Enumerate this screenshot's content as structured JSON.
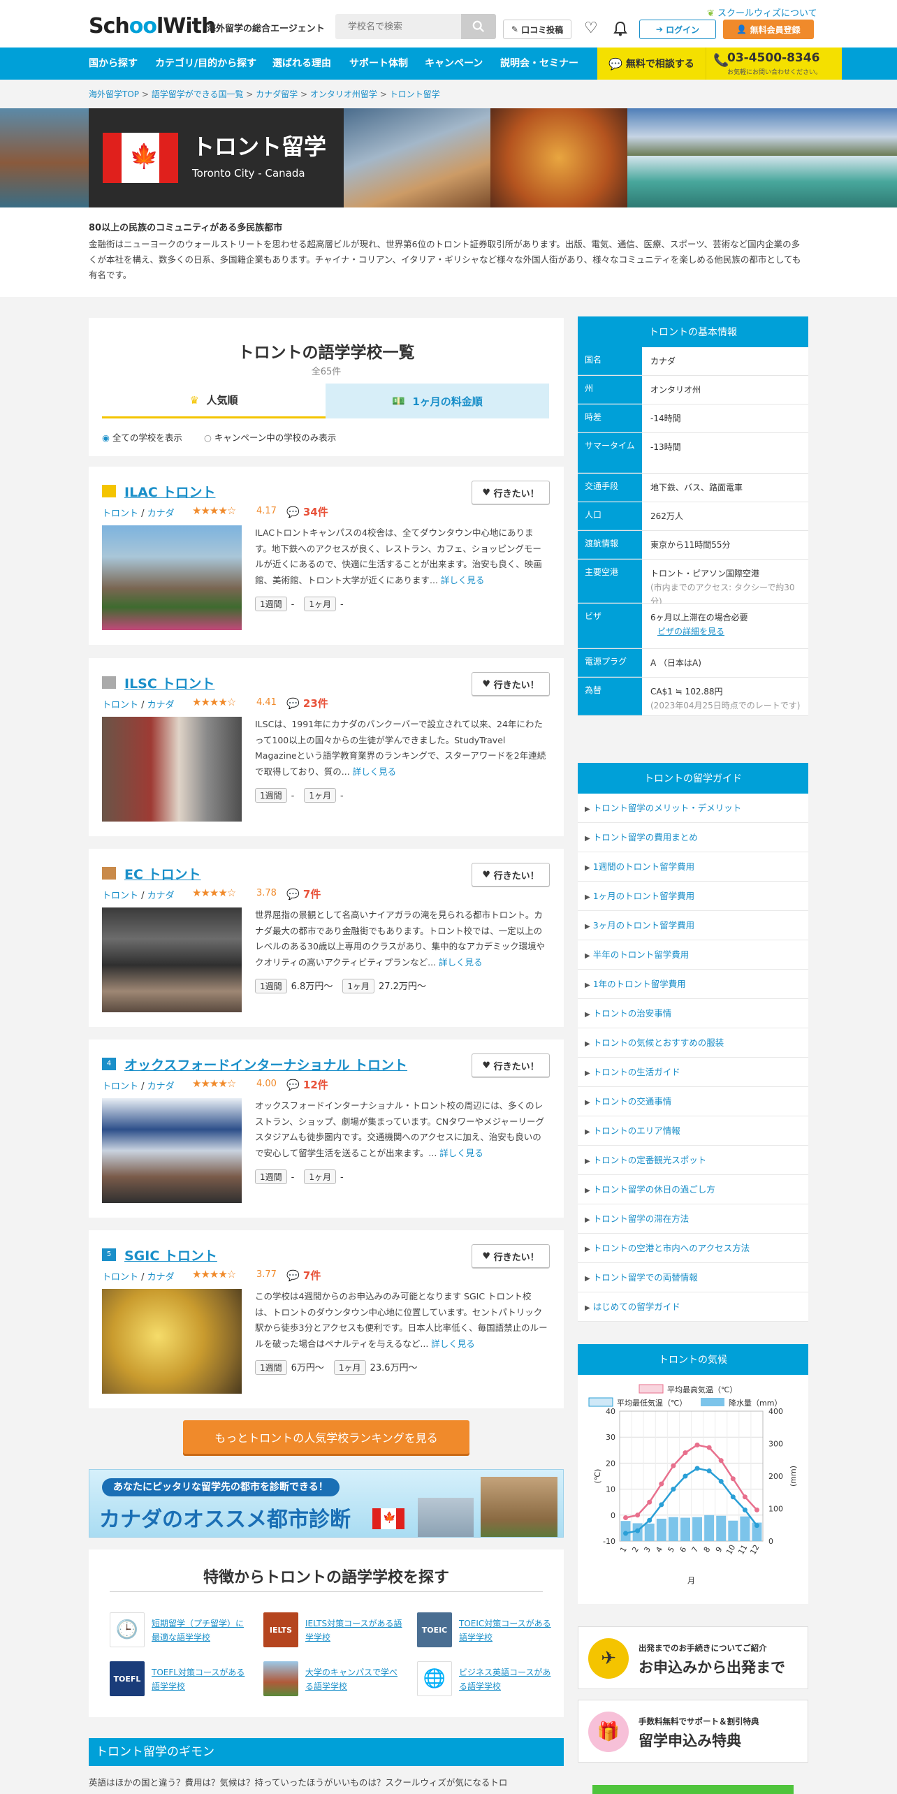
{
  "header": {
    "logo_pre": "Sch",
    "logo_oo": "oo",
    "logo_post": "lWith",
    "tagline": "海外留学の総合エージェント",
    "about": "スクールウィズについて",
    "search_placeholder": "学校名で検索",
    "review_btn": "口コミ投稿",
    "login_btn": "ログイン",
    "register_btn": "無料会員登録"
  },
  "nav": {
    "items": [
      "国から探す",
      "カテゴリ/目的から探す",
      "選ばれる理由",
      "サポート体制",
      "キャンペーン",
      "説明会・セミナー"
    ],
    "consult": "無料で相談する",
    "phone": "03-4500-8346",
    "phone_note": "お気軽にお問い合わせください。"
  },
  "breadcrumb": [
    "海外留学TOP",
    "語学留学ができる国一覧",
    "カナダ留学",
    "オンタリオ州留学",
    "トロント留学"
  ],
  "hero": {
    "title": "トロント留学",
    "subtitle": "Toronto City - Canada"
  },
  "intro": {
    "heading": "80以上の民族のコミュニティがある多民族都市",
    "body": "金融街はニューヨークのウォールストリートを思わせる超高層ビルが現れ、世界第6位のトロント証券取引所があります。出版、電気、通信、医療、スポーツ、芸術など国内企業の多くが本社を構え、数多くの日系、多国籍企業もあります。チャイナ・コリアン、イタリア・ギリシャなど様々な外国人街があり、様々なコミュニティを楽しめる他民族の都市としても有名です。"
  },
  "list": {
    "title": "トロントの語学学校一覧",
    "count": "全65件",
    "tab_popular": "人気順",
    "tab_price": "1ヶ月の料金順",
    "radio_all": "全ての学校を表示",
    "radio_campaign": "キャンペーン中の学校のみ表示",
    "want_label": "行きたい！",
    "loc_city": "トロント",
    "loc_country": "カナダ",
    "week_label": "1週間",
    "month_label": "1ヶ月",
    "more_label": "詳しく見る"
  },
  "schools": [
    {
      "rank": "1",
      "name": "ILAC トロント",
      "rating": "4.17",
      "stars": 4.17,
      "reviews": "34件",
      "desc": "ILACトロントキャンパスの4校舎は、全てダウンタウン中心地にあります。地下鉄へのアクセスが良く、レストラン、カフェ、ショッピングモールが近くにあるので、快適に生活することが出来ます。治安も良く、映画館、美術館、トロント大学が近くにあります...",
      "week_price": "-",
      "month_price": "-"
    },
    {
      "rank": "2",
      "name": "ILSC トロント",
      "rating": "4.41",
      "stars": 4.41,
      "reviews": "23件",
      "desc": "ILSCは、1991年にカナダのバンクーバーで設立されて以来、24年にわたって100以上の国々からの生徒が学んできました。StudyTravel Magazineという語学教育業界のランキングで、スターアワードを2年連続で取得しており、質の...",
      "week_price": "-",
      "month_price": "-"
    },
    {
      "rank": "3",
      "name": "EC トロント",
      "rating": "3.78",
      "stars": 3.78,
      "reviews": "7件",
      "desc": "世界屈指の景観として名高いナイアガラの滝を見られる都市トロント。カナダ最大の都市であり金融街でもあります。トロント校では、一定以上のレベルのある30歳以上専用のクラスがあり、集中的なアカデミック環境やクオリティの高いアクティビティプランなど...",
      "week_price": "6.8万円〜",
      "month_price": "27.2万円〜"
    },
    {
      "rank": "4",
      "name": "オックスフォードインターナショナル トロント",
      "rating": "4.00",
      "stars": 4.0,
      "reviews": "12件",
      "desc": "オックスフォードインターナショナル・トロント校の周辺には、多くのレストラン、ショップ、劇場が集まっています。CNタワーやメジャーリーグスタジアムも徒歩圏内です。交通機関へのアクセスに加え、治安も良いので安心して留学生活を送ることが出来ます。...",
      "week_price": "-",
      "month_price": "-"
    },
    {
      "rank": "5",
      "name": "SGIC トロント",
      "rating": "3.77",
      "stars": 3.77,
      "reviews": "7件",
      "desc": "この学校は4週間からのお申込みのみ可能となります SGIC トロント校は、トロントのダウンタウン中心地に位置しています。セントパトリック駅から徒歩3分とアクセスも便利です。日本人比率低く、毎国語禁止のルールを破った場合はペナルティを与えるなど...",
      "week_price": "6万円〜",
      "month_price": "23.6万円〜"
    }
  ],
  "more_ranking": "もっとトロントの人気学校ランキングを見る",
  "banner": {
    "top": "あなたにピッタリな留学先の都市を診断できる！",
    "main": "カナダのオススメ都市診断"
  },
  "features": {
    "title": "特徴からトロントの語学学校を探す",
    "items": [
      {
        "icon": "clock-icon",
        "badge": "",
        "label": "短期留学（プチ留学）に最適な語学学校"
      },
      {
        "icon": "ielts-icon",
        "badge": "IELTS",
        "label": "IELTS対策コースがある語学学校"
      },
      {
        "icon": "toeic-icon",
        "badge": "TOEIC",
        "label": "TOEIC対策コースがある語学学校"
      },
      {
        "icon": "toefl-icon",
        "badge": "TOEFL",
        "label": "TOEFL対策コースがある語学学校"
      },
      {
        "icon": "campus-icon",
        "badge": "",
        "label": "大学のキャンパスで学べる語学学校"
      },
      {
        "icon": "globe-icon",
        "badge": "",
        "label": "ビジネス英語コースがある語学学校"
      }
    ]
  },
  "faq": {
    "title": "トロント留学のギモン",
    "text": "英語はほかの国と違う？費用は？気候は？持っていったほうがいいものは？スクールウィズが気になるトロ"
  },
  "basic_info": {
    "title": "トロントの基本情報",
    "rows": [
      {
        "k": "国名",
        "v": "カナダ",
        "sub": ""
      },
      {
        "k": "州",
        "v": "オンタリオ州",
        "sub": ""
      },
      {
        "k": "時差",
        "v": "-14時間",
        "sub": ""
      },
      {
        "k": "サマータイム",
        "v": "-13時間",
        "sub": ""
      },
      {
        "k": "交通手段",
        "v": "地下鉄、バス、路面電車",
        "sub": ""
      },
      {
        "k": "人口",
        "v": "262万人",
        "sub": ""
      },
      {
        "k": "渡航情報",
        "v": "東京から11時間55分",
        "sub": ""
      },
      {
        "k": "主要空港",
        "v": "トロント・ピアソン国際空港",
        "sub": "(市内までのアクセス: タクシーで約30分)"
      },
      {
        "k": "ビザ",
        "v": "6ヶ月以上滞在の場合必要",
        "sub": "ビザの詳細を見る"
      },
      {
        "k": "電源プラグ",
        "v": "A （日本はA)",
        "sub": ""
      },
      {
        "k": "為替",
        "v": "CA$1 ≒ 102.88円",
        "sub": "(2023年04月25日時点でのレートです)"
      }
    ]
  },
  "guide": {
    "title": "トロントの留学ガイド",
    "items": [
      "トロント留学のメリット・デメリット",
      "トロント留学の費用まとめ",
      "1週間のトロント留学費用",
      "1ヶ月のトロント留学費用",
      "3ヶ月のトロント留学費用",
      "半年のトロント留学費用",
      "1年のトロント留学費用",
      "トロントの治安事情",
      "トロントの気候とおすすめの服装",
      "トロントの生活ガイド",
      "トロントの交通事情",
      "トロントのエリア情報",
      "トロントの定番観光スポット",
      "トロント留学の休日の過ごし方",
      "トロント留学の滞在方法",
      "トロントの空港と市内へのアクセス方法",
      "トロント留学での両替情報",
      "はじめての留学ガイド"
    ]
  },
  "climate": {
    "title": "トロントの気候",
    "legend_high": "平均最高気温（℃）",
    "legend_low": "平均最低気温（℃）",
    "legend_rain": "降水量（mm）",
    "ylabel_left": "(℃)",
    "ylabel_right": "(mm)",
    "xlabel": "月"
  },
  "chart_data": {
    "type": "line",
    "x": [
      1,
      2,
      3,
      4,
      5,
      6,
      7,
      8,
      9,
      10,
      11,
      12
    ],
    "categories": [
      "1",
      "2",
      "3",
      "4",
      "5",
      "6",
      "7",
      "8",
      "9",
      "10",
      "11",
      "12"
    ],
    "series": [
      {
        "name": "平均最高気温（℃）",
        "values": [
          -1,
          0,
          5,
          12,
          19,
          24,
          27,
          26,
          21,
          14,
          7,
          2
        ]
      },
      {
        "name": "平均最低気温（℃）",
        "values": [
          -7,
          -6,
          -2,
          4,
          10,
          15,
          18,
          17,
          13,
          7,
          2,
          -4
        ]
      },
      {
        "name": "降水量（mm）",
        "values": [
          62,
          55,
          54,
          69,
          74,
          72,
          74,
          80,
          78,
          63,
          76,
          57
        ]
      }
    ],
    "ylim_left": [
      -10,
      40
    ],
    "ylim_right": [
      0,
      400
    ],
    "yticks_left": [
      "40",
      "30",
      "20",
      "10",
      "0",
      "-10"
    ],
    "yticks_right": [
      "400",
      "300",
      "200",
      "100",
      "0"
    ],
    "colors": {
      "high": "#e8708d",
      "low": "#2a9fd6",
      "rain": "#7cc4ea"
    }
  },
  "side_banners": {
    "flow_small": "出発までのお手続きについてご紹介",
    "flow_big": "お申込みから出発まで",
    "perk_small": "手数料無料でサポート＆割引特典",
    "perk_big": "留学申込み特典"
  },
  "colors": {
    "brand": "#00a0d8",
    "accent": "#f08a2b",
    "yellow": "#f4e000"
  }
}
